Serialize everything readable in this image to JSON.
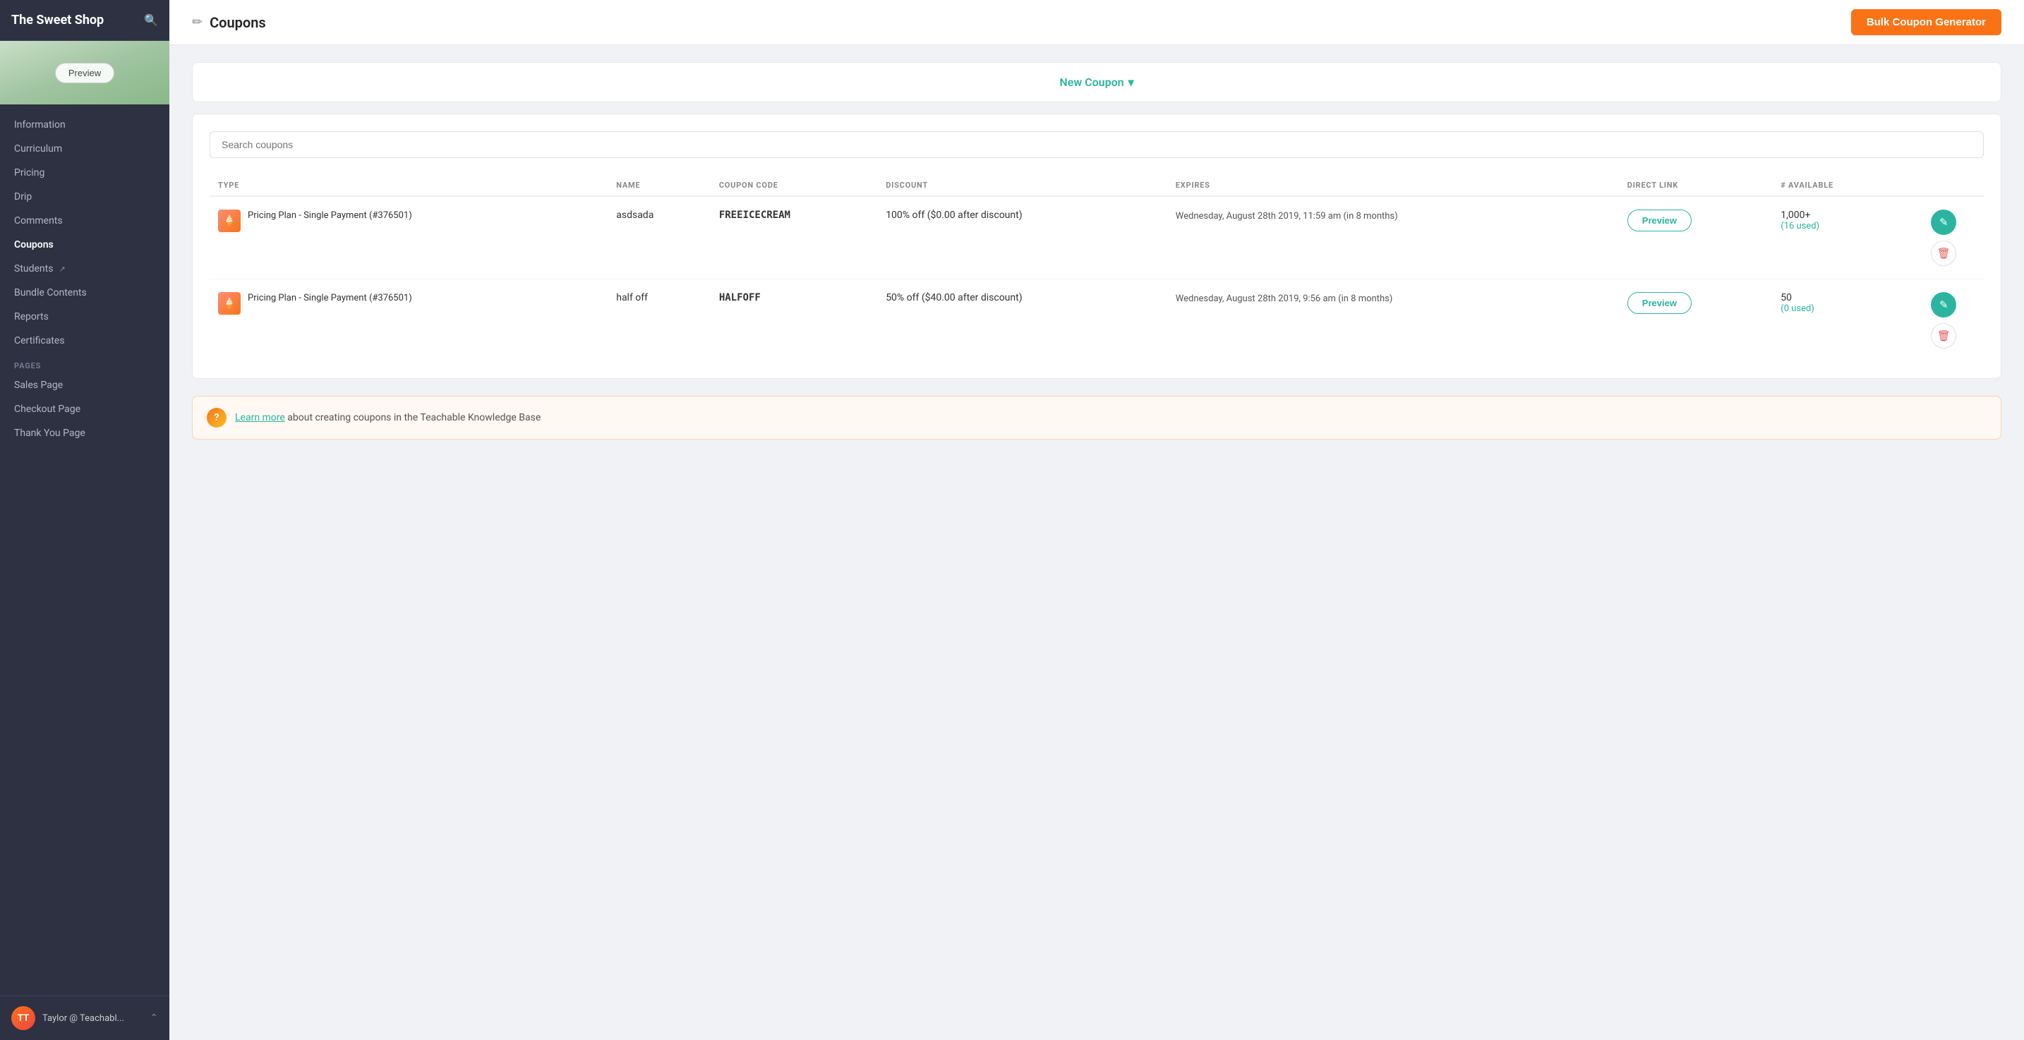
{
  "sidebar": {
    "title": "The Sweet Shop",
    "preview_label": "Preview",
    "nav_items": [
      {
        "id": "information",
        "label": "Information",
        "active": false
      },
      {
        "id": "curriculum",
        "label": "Curriculum",
        "active": false
      },
      {
        "id": "pricing",
        "label": "Pricing",
        "active": false
      },
      {
        "id": "drip",
        "label": "Drip",
        "active": false
      },
      {
        "id": "comments",
        "label": "Comments",
        "active": false
      },
      {
        "id": "coupons",
        "label": "Coupons",
        "active": true
      },
      {
        "id": "students",
        "label": "Students",
        "active": false,
        "external": true
      },
      {
        "id": "bundle-contents",
        "label": "Bundle Contents",
        "active": false
      },
      {
        "id": "reports",
        "label": "Reports",
        "active": false
      },
      {
        "id": "certificates",
        "label": "Certificates",
        "active": false
      }
    ],
    "pages_label": "PAGES",
    "pages_items": [
      {
        "id": "sales-page",
        "label": "Sales Page"
      },
      {
        "id": "checkout-page",
        "label": "Checkout Page"
      },
      {
        "id": "thank-you-page",
        "label": "Thank You Page"
      }
    ],
    "footer_user": "Taylor @ Teachabl...",
    "footer_initials": "TT"
  },
  "topbar": {
    "icon": "✏",
    "title": "Coupons",
    "bulk_coupon_btn": "Bulk Coupon Generator"
  },
  "new_coupon": {
    "label": "New Coupon",
    "chevron": "▾"
  },
  "search": {
    "placeholder": "Search coupons"
  },
  "table": {
    "headers": [
      "TYPE",
      "NAME",
      "COUPON CODE",
      "DISCOUNT",
      "EXPIRES",
      "DIRECT LINK",
      "# AVAILABLE",
      ""
    ],
    "rows": [
      {
        "type": "Pricing Plan - Single Payment (#376501)",
        "name": "asdsada",
        "coupon_code": "FREEICECREAM",
        "discount": "100% off ($0.00 after discount)",
        "expires": "Wednesday, August 28th 2019, 11:59 am (in 8 months)",
        "preview_label": "Preview",
        "available": "1,000+",
        "used": "(16 used)"
      },
      {
        "type": "Pricing Plan - Single Payment (#376501)",
        "name": "half off",
        "coupon_code": "HALFOFF",
        "discount": "50% off ($40.00 after discount)",
        "expires": "Wednesday, August 28th 2019, 9:56 am (in 8 months)",
        "preview_label": "Preview",
        "available": "50",
        "used": "(0 used)"
      }
    ]
  },
  "info_banner": {
    "icon": "?",
    "text_before": "Learn more",
    "text_after": " about creating coupons in the Teachable Knowledge Base"
  }
}
